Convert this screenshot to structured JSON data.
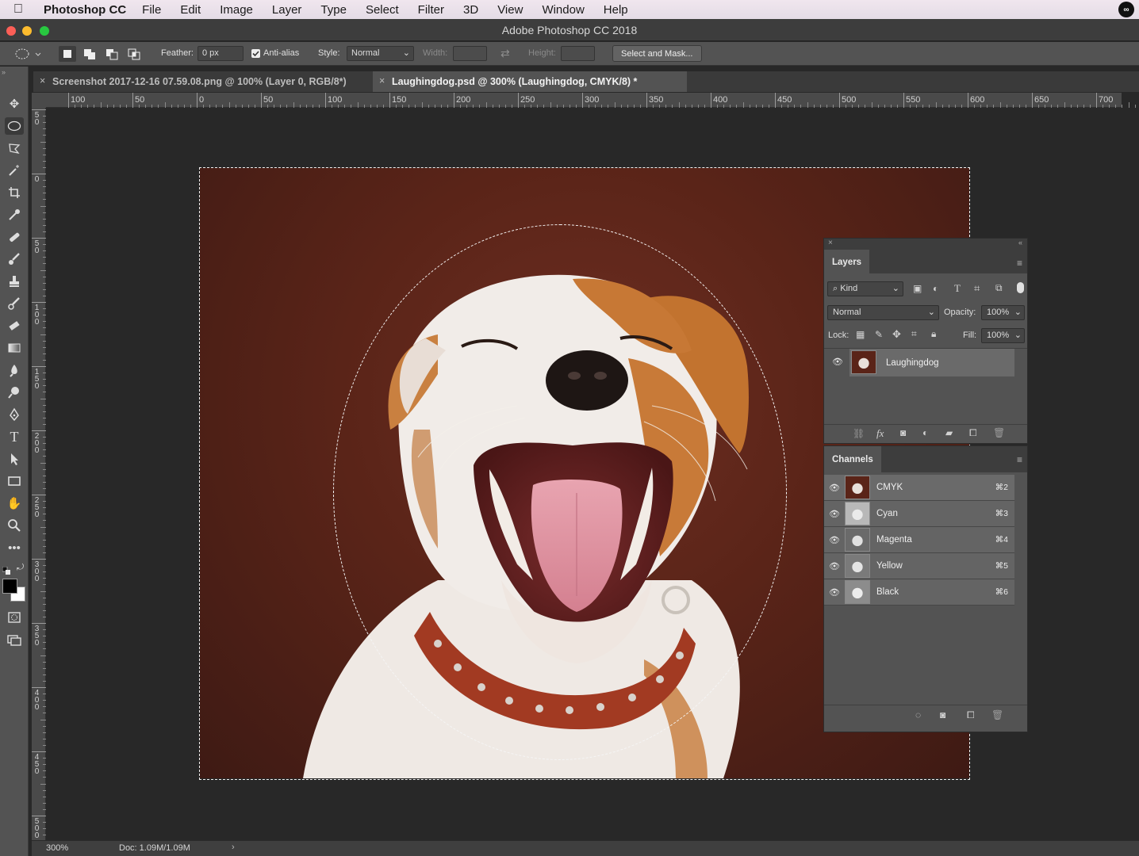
{
  "menubar": {
    "app_name": "Photoshop CC",
    "items": [
      "File",
      "Edit",
      "Image",
      "Layer",
      "Type",
      "Select",
      "Filter",
      "3D",
      "View",
      "Window",
      "Help"
    ]
  },
  "window": {
    "title": "Adobe Photoshop CC 2018"
  },
  "options": {
    "feather_label": "Feather:",
    "feather_value": "0 px",
    "antialias_label": "Anti-alias",
    "style_label": "Style:",
    "style_value": "Normal",
    "width_label": "Width:",
    "height_label": "Height:",
    "select_mask_label": "Select and Mask..."
  },
  "tabs": [
    {
      "label": "Screenshot 2017-12-16 07.59.08.png @ 100% (Layer 0, RGB/8*)",
      "active": false
    },
    {
      "label": "Laughingdog.psd @ 300% (Laughingdog, CMYK/8) *",
      "active": true
    }
  ],
  "ruler": {
    "top_labels": [
      "100",
      "50",
      "0",
      "50",
      "100",
      "150",
      "200",
      "250",
      "300",
      "350",
      "400",
      "450",
      "500",
      "550",
      "600",
      "650",
      "700"
    ],
    "left_labels": [
      "50",
      "0",
      "50",
      "100",
      "150",
      "200",
      "250",
      "300",
      "350",
      "400",
      "450",
      "500"
    ]
  },
  "status": {
    "zoom": "300%",
    "doc": "Doc: 1.09M/1.09M"
  },
  "layers_panel": {
    "tab_label": "Layers",
    "filter_label": "Kind",
    "blend_mode": "Normal",
    "opacity_label": "Opacity:",
    "opacity_value": "100%",
    "lock_label": "Lock:",
    "fill_label": "Fill:",
    "fill_value": "100%",
    "layers": [
      {
        "name": "Laughingdog"
      }
    ]
  },
  "channels_panel": {
    "tab_label": "Channels",
    "channels": [
      {
        "name": "CMYK",
        "shortcut": "⌘2"
      },
      {
        "name": "Cyan",
        "shortcut": "⌘3"
      },
      {
        "name": "Magenta",
        "shortcut": "⌘4"
      },
      {
        "name": "Yellow",
        "shortcut": "⌘5"
      },
      {
        "name": "Black",
        "shortcut": "⌘6"
      }
    ]
  },
  "colors": {
    "foreground": "#000000",
    "background": "#ffffff"
  }
}
